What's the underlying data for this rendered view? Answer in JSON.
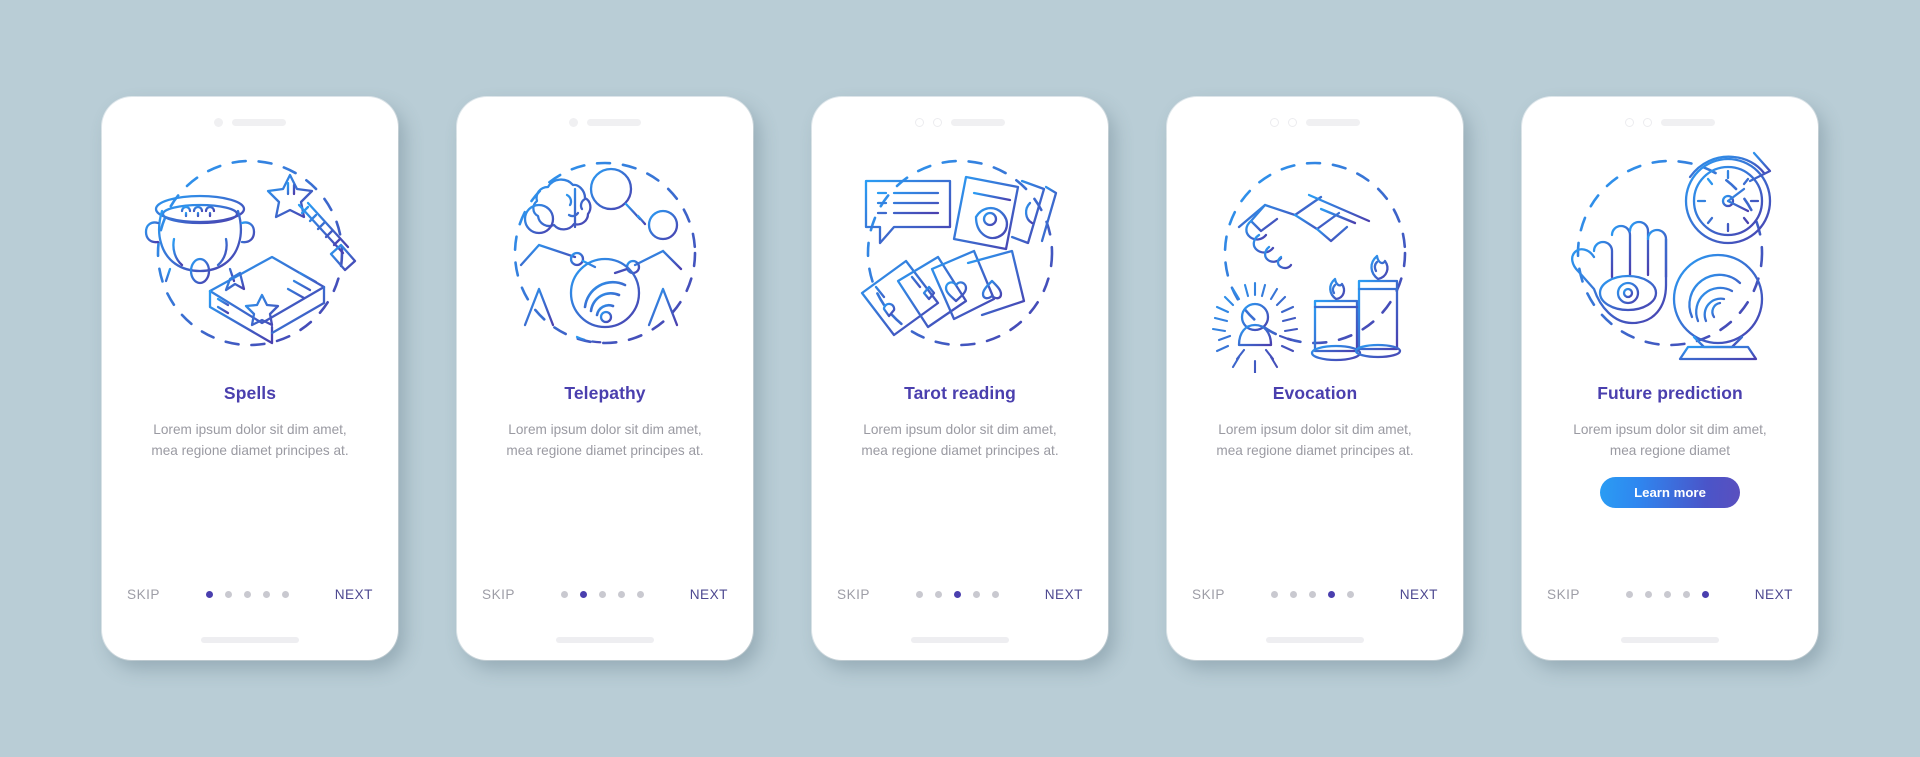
{
  "app": {
    "background_color": "#b9cdd6",
    "title_color": "#4a3fae",
    "body_color": "#9a9aa2",
    "next_color": "#4d4890",
    "skip_color": "#9d9da6",
    "dot_active_color": "#4a3fae",
    "dot_inactive_color": "#c9c9d0",
    "illustration_gradient_start": "#2a9df4",
    "illustration_gradient_end": "#4a3fae",
    "button_gradient_start": "#2a9df4",
    "button_gradient_end": "#5a4fbe",
    "total_screens": 5
  },
  "common": {
    "skip_label": "SKIP",
    "next_label": "NEXT",
    "body_text": "Lorem ipsum dolor sit dim amet, mea regione diamet principes at."
  },
  "screens": [
    {
      "index": 1,
      "title": "Spells",
      "body": "Lorem ipsum dolor sit dim amet, mea regione diamet principes at.",
      "skip_label": "SKIP",
      "next_label": "NEXT",
      "active_dot": 1,
      "has_cta": false,
      "cta_label": "",
      "illustration_name": "cauldron-wand-spellbook",
      "illustration_items": [
        "cauldron",
        "magic-wand-star",
        "spell-book"
      ],
      "camera_style": "single-dot"
    },
    {
      "index": 2,
      "title": "Telepathy",
      "body": "Lorem ipsum dolor sit dim amet, mea regione diamet principes at.",
      "skip_label": "SKIP",
      "next_label": "NEXT",
      "active_dot": 2,
      "has_cta": false,
      "cta_label": "",
      "illustration_name": "telepathy-figures-brain",
      "illustration_items": [
        "brain",
        "magnifier",
        "two-stick-figures",
        "signal-waves"
      ],
      "camera_style": "single-dot"
    },
    {
      "index": 3,
      "title": "Tarot reading",
      "body": "Lorem ipsum dolor sit dim amet, mea regione diamet principes at.",
      "skip_label": "SKIP",
      "next_label": "NEXT",
      "active_dot": 3,
      "has_cta": false,
      "cta_label": "",
      "illustration_name": "tarot-cards-speech-bubble",
      "illustration_items": [
        "speech-bubble",
        "eye-moon-tarot-card",
        "playing-card-fan"
      ],
      "camera_style": "double-ring"
    },
    {
      "index": 4,
      "title": "Evocation",
      "body": "Lorem ipsum dolor sit dim amet, mea regione diamet principes at.",
      "skip_label": "SKIP",
      "next_label": "NEXT",
      "active_dot": 4,
      "has_cta": false,
      "cta_label": "",
      "illustration_name": "handshake-spirit-candles",
      "illustration_items": [
        "handshake",
        "radiating-spirit",
        "two-candles"
      ],
      "camera_style": "double-ring"
    },
    {
      "index": 5,
      "title": "Future prediction",
      "body": "Lorem ipsum dolor sit dim amet, mea regione diamet",
      "skip_label": "SKIP",
      "next_label": "NEXT",
      "active_dot": 5,
      "has_cta": true,
      "cta_label": "Learn more",
      "illustration_name": "palm-clock-crystalball",
      "illustration_items": [
        "palm-with-eye",
        "clock-with-arrow",
        "crystal-ball"
      ],
      "camera_style": "double-ring"
    }
  ]
}
